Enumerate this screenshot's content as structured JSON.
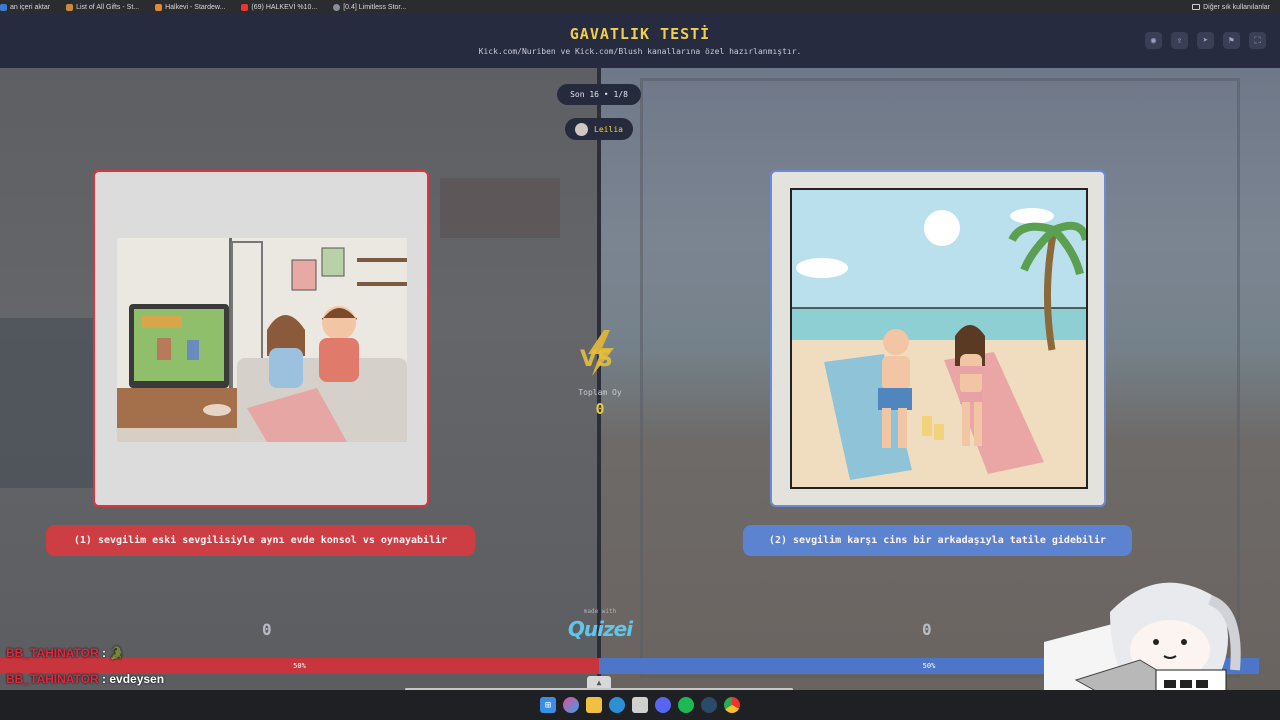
{
  "bookmarks": [
    {
      "label": "an içeri aktar",
      "color": "#3a7bd5"
    },
    {
      "label": "List of All Gifts - St...",
      "color": "#c98a3a"
    },
    {
      "label": "Halkevi - Stardew...",
      "color": "#e0883a"
    },
    {
      "label": "(69) HALKEVİ %10...",
      "color": "#e33"
    },
    {
      "label": "[0.4] Limitless Stor...",
      "color": "#8a8f9a"
    }
  ],
  "bookmarks_right": "Diğer sık kullanılanlar",
  "header": {
    "title": "GAVATLIK TESTİ",
    "subtitle": "Kick.com/Nuriben ve Kick.com/Blush kanallarına özel hazırlanmıştır.",
    "icons": [
      "eye-icon",
      "share-icon",
      "send-icon",
      "flag-icon",
      "fullscreen-icon"
    ]
  },
  "round": "Son 16 • 1/8",
  "user": {
    "name": "Leilia"
  },
  "total": {
    "label": "Toplam Oy",
    "value": "0"
  },
  "options": {
    "left": {
      "label": "(1) sevgilim eski sevgilisiyle aynı evde konsol vs oynayabilir",
      "votes": "0",
      "percent": "50%"
    },
    "right": {
      "label": "(2) sevgilim karşı cins bir arkadaşıyla tatile gidebilir",
      "votes": "0",
      "percent": "50%"
    }
  },
  "brand": {
    "made_with": "made with",
    "name": "Quizei"
  },
  "chat": [
    {
      "user": "BB_TAHINATOR",
      "sep": " : ",
      "message": "🐊"
    },
    {
      "user": "BB_TAHINATOR",
      "sep": " : ",
      "message": "evdeysen"
    }
  ],
  "taskbar": [
    "windows-icon",
    "copilot-icon",
    "files-icon",
    "edge-icon",
    "store-icon",
    "discord-icon",
    "spotify-icon",
    "steam-icon",
    "chrome-icon"
  ],
  "colors": {
    "accent": "#f2cf4a",
    "left": "#cc3d44",
    "right": "#5b83cf",
    "header": "#272b3f"
  }
}
